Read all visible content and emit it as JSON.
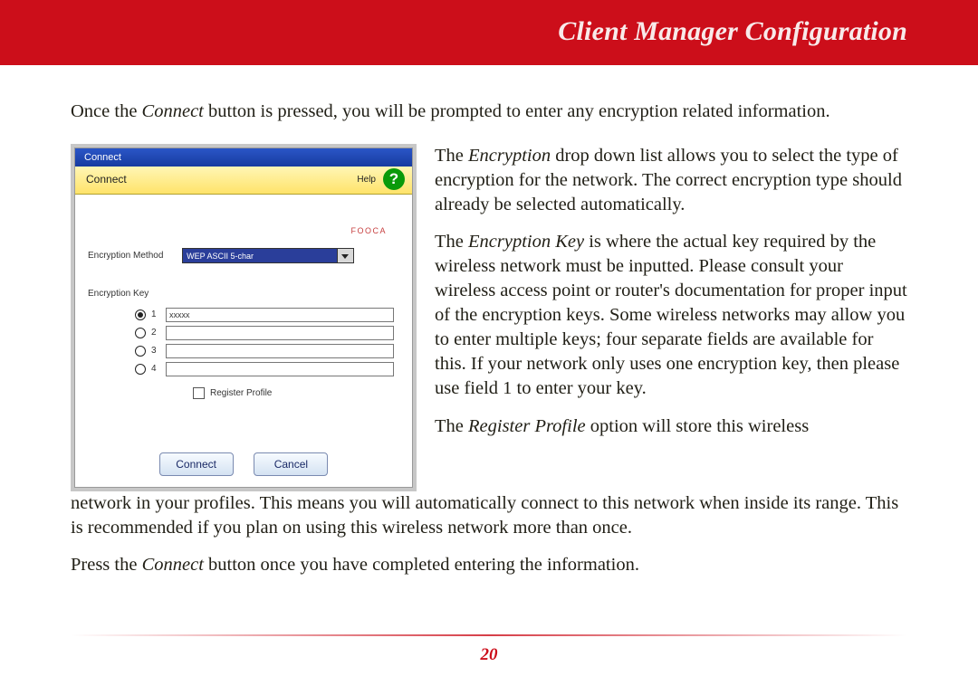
{
  "header": {
    "title": "Client Manager Configuration"
  },
  "intro_pre": "Once the ",
  "intro_kw": "Connect",
  "intro_post": " button is pressed, you will be prompted to enter any encryption related information.",
  "screenshot": {
    "window_title": "Connect",
    "soft_title": "Connect",
    "help_label": "Help",
    "help_icon_char": "?",
    "network_name": "FOOCA",
    "enc_method_label": "Encryption Method",
    "enc_method_value": "WEP ASCII 5-char",
    "enc_key_label": "Encryption Key",
    "keys": [
      {
        "n": "1",
        "value": "xxxxx",
        "selected": true
      },
      {
        "n": "2",
        "value": "",
        "selected": false
      },
      {
        "n": "3",
        "value": "",
        "selected": false
      },
      {
        "n": "4",
        "value": "",
        "selected": false
      }
    ],
    "register_profile_label": "Register Profile",
    "connect_btn": "Connect",
    "cancel_btn": "Cancel"
  },
  "para1_pre": "The ",
  "para1_kw": "Encryption",
  "para1_post": " drop down list allows you to select the type of encryption for the network. The correct encryption type should already be selected automatically.",
  "para2_pre": "The ",
  "para2_kw": "Encryption Key",
  "para2_post": " is where the actual key required by the wireless network must be inputted.  Please consult your wireless access point or router's documentation for proper input of the encryption keys.  Some wireless networks may allow you to enter multiple keys; four separate fields are available for this.  If your network only uses one encryption key, then please use field 1 to enter your key.",
  "para3_pre": "The ",
  "para3_kw": "Register Profile",
  "para3_right": " option will store this wireless",
  "para3_wrap": "network in your profiles.  This means you will automatically connect to this network when inside its range. This is recommended if you plan on using this wireless network more than once.",
  "para4_pre": "Press the ",
  "para4_kw": "Connect",
  "para4_post": " button once you have completed entering the information.",
  "page_number": "20"
}
